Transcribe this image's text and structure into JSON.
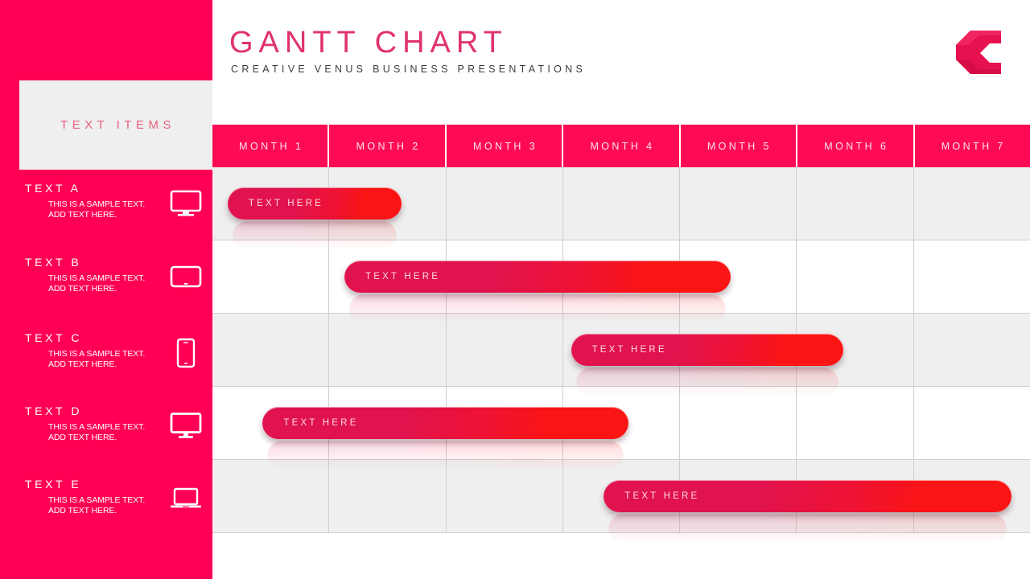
{
  "header": {
    "title": "GANTT CHART",
    "subtitle": "CREATIVE VENUS BUSINESS PRESENTATIONS",
    "logo_icon": "angular-c-logo-icon",
    "title_color": "#e0336b",
    "subtitle_color": "#3c3c3c"
  },
  "sidebar": {
    "background_color": "#ff0055",
    "panel": {
      "label": "TEXT ITEMS",
      "background_color": "#efefef",
      "label_color": "#e8607f"
    },
    "items": [
      {
        "title": "TEXT A",
        "desc_line1": "THIS IS A SAMPLE TEXT.",
        "desc_line2": "ADD TEXT HERE.",
        "icon": "tv-monitor-icon"
      },
      {
        "title": "TEXT B",
        "desc_line1": "THIS IS A SAMPLE TEXT.",
        "desc_line2": "ADD TEXT HERE.",
        "icon": "tablet-icon"
      },
      {
        "title": "TEXT C",
        "desc_line1": "THIS IS A SAMPLE TEXT.",
        "desc_line2": "ADD TEXT HERE.",
        "icon": "smartphone-icon"
      },
      {
        "title": "TEXT D",
        "desc_line1": "THIS IS A SAMPLE TEXT.",
        "desc_line2": "ADD TEXT HERE.",
        "icon": "desktop-monitor-icon"
      },
      {
        "title": "TEXT E",
        "desc_line1": "THIS IS A SAMPLE TEXT.",
        "desc_line2": "ADD TEXT HERE.",
        "icon": "laptop-icon"
      }
    ]
  },
  "chart_data": {
    "type": "bar",
    "title": "GANTT CHART",
    "subtitle": "CREATIVE VENUS BUSINESS PRESENTATIONS",
    "xlabel": "",
    "ylabel": "TEXT ITEMS",
    "orientation": "horizontal",
    "grid": true,
    "legend": "none",
    "categories": [
      "MONTH 1",
      "MONTH 2",
      "MONTH 3",
      "MONTH 4",
      "MONTH 5",
      "MONTH 6",
      "MONTH 7"
    ],
    "xlim": [
      0,
      7
    ],
    "tasks": [
      {
        "row": "TEXT A",
        "label": "TEXT HERE",
        "start_month": 0.13,
        "end_month": 1.62,
        "row_shade": "shaded"
      },
      {
        "row": "TEXT B",
        "label": "TEXT HERE",
        "start_month": 1.13,
        "end_month": 4.44,
        "row_shade": "plain"
      },
      {
        "row": "TEXT C",
        "label": "TEXT HERE",
        "start_month": 3.07,
        "end_month": 5.4,
        "row_shade": "shaded"
      },
      {
        "row": "TEXT D",
        "label": "TEXT HERE",
        "start_month": 0.43,
        "end_month": 3.56,
        "row_shade": "plain"
      },
      {
        "row": "TEXT E",
        "label": "TEXT HERE",
        "start_month": 3.35,
        "end_month": 6.84,
        "row_shade": "shaded"
      }
    ],
    "bar_gradient": [
      "#e0134e",
      "#fa1414"
    ],
    "header_color": "#ff0a55",
    "row_shade_color": "#efefef",
    "gridline_color": "#cfcfcf"
  }
}
